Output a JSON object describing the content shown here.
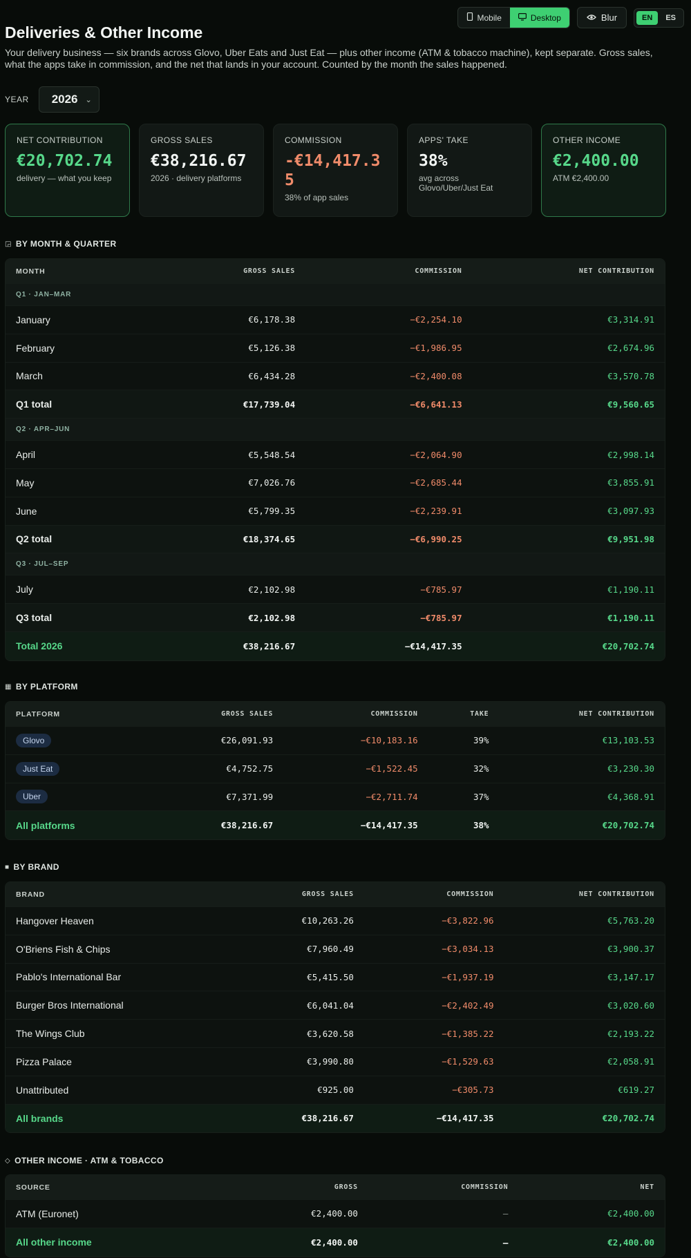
{
  "topbar": {
    "mobile_label": "Mobile",
    "desktop_label": "Desktop",
    "blur_label": "Blur",
    "lang_en": "EN",
    "lang_es": "ES"
  },
  "page": {
    "title": "Deliveries & Other Income",
    "subtitle": "Your delivery business — six brands across Glovo, Uber Eats and Just Eat — plus other income (ATM & tobacco machine), kept separate. Gross sales, what the apps take in commission, and the net that lands in your account. Counted by the month the sales happened."
  },
  "year": {
    "label": "YEAR",
    "value": "2026"
  },
  "cards": [
    {
      "label": "NET CONTRIBUTION",
      "value": "€20,702.74",
      "sub": "delivery — what you keep"
    },
    {
      "label": "GROSS SALES",
      "value": "€38,216.67",
      "sub": "2026 · delivery platforms"
    },
    {
      "label": "COMMISSION",
      "value": "-€14,417.35",
      "sub": "38% of app sales"
    },
    {
      "label": "APPS' TAKE",
      "value": "38%",
      "sub": "avg across Glovo/Uber/Just Eat"
    },
    {
      "label": "OTHER INCOME",
      "value": "€2,400.00",
      "sub": "ATM €2,400.00"
    }
  ],
  "month_section": {
    "title": "BY MONTH & QUARTER",
    "headers": [
      "MONTH",
      "GROSS SALES",
      "COMMISSION",
      "NET CONTRIBUTION"
    ],
    "q1": "Q1 · JAN–MAR",
    "q2": "Q2 · APR–JUN",
    "q3": "Q3 · JUL–SEP",
    "rows": {
      "jan": [
        "January",
        "€6,178.38",
        "−€2,254.10",
        "€3,314.91"
      ],
      "feb": [
        "February",
        "€5,126.38",
        "−€1,986.95",
        "€2,674.96"
      ],
      "mar": [
        "March",
        "€6,434.28",
        "−€2,400.08",
        "€3,570.78"
      ],
      "q1t": [
        "Q1 total",
        "€17,739.04",
        "−€6,641.13",
        "€9,560.65"
      ],
      "apr": [
        "April",
        "€5,548.54",
        "−€2,064.90",
        "€2,998.14"
      ],
      "may": [
        "May",
        "€7,026.76",
        "−€2,685.44",
        "€3,855.91"
      ],
      "jun": [
        "June",
        "€5,799.35",
        "−€2,239.91",
        "€3,097.93"
      ],
      "q2t": [
        "Q2 total",
        "€18,374.65",
        "−€6,990.25",
        "€9,951.98"
      ],
      "jul": [
        "July",
        "€2,102.98",
        "−€785.97",
        "€1,190.11"
      ],
      "q3t": [
        "Q3 total",
        "€2,102.98",
        "−€785.97",
        "€1,190.11"
      ],
      "year": [
        "Total 2026",
        "€38,216.67",
        "−€14,417.35",
        "€20,702.74"
      ]
    }
  },
  "platform_section": {
    "title": "BY PLATFORM",
    "headers": [
      "PLATFORM",
      "GROSS SALES",
      "COMMISSION",
      "TAKE",
      "NET CONTRIBUTION"
    ],
    "rows": [
      [
        "Glovo",
        "€26,091.93",
        "−€10,183.16",
        "39%",
        "€13,103.53"
      ],
      [
        "Just Eat",
        "€4,752.75",
        "−€1,522.45",
        "32%",
        "€3,230.30"
      ],
      [
        "Uber",
        "€7,371.99",
        "−€2,711.74",
        "37%",
        "€4,368.91"
      ]
    ],
    "total": [
      "All platforms",
      "€38,216.67",
      "−€14,417.35",
      "38%",
      "€20,702.74"
    ]
  },
  "brand_section": {
    "title": "BY BRAND",
    "headers": [
      "BRAND",
      "GROSS SALES",
      "COMMISSION",
      "NET CONTRIBUTION"
    ],
    "rows": [
      [
        "Hangover Heaven",
        "€10,263.26",
        "−€3,822.96",
        "€5,763.20"
      ],
      [
        "O'Briens Fish & Chips",
        "€7,960.49",
        "−€3,034.13",
        "€3,900.37"
      ],
      [
        "Pablo's International Bar",
        "€5,415.50",
        "−€1,937.19",
        "€3,147.17"
      ],
      [
        "Burger Bros International",
        "€6,041.04",
        "−€2,402.49",
        "€3,020.60"
      ],
      [
        "The Wings Club",
        "€3,620.58",
        "−€1,385.22",
        "€2,193.22"
      ],
      [
        "Pizza Palace",
        "€3,990.80",
        "−€1,529.63",
        "€2,058.91"
      ],
      [
        "Unattributed",
        "€925.00",
        "−€305.73",
        "€619.27"
      ]
    ],
    "total": [
      "All brands",
      "€38,216.67",
      "−€14,417.35",
      "€20,702.74"
    ]
  },
  "other_section": {
    "title": "OTHER INCOME · ATM & TOBACCO",
    "headers": [
      "SOURCE",
      "GROSS",
      "COMMISSION",
      "NET"
    ],
    "rows": [
      [
        "ATM (Euronet)",
        "€2,400.00",
        "–",
        "€2,400.00"
      ]
    ],
    "total": [
      "All other income",
      "€2,400.00",
      "–",
      "€2,400.00"
    ]
  },
  "colors": {
    "accent": "#3ecf72",
    "positive": "#57d88a",
    "negative": "#f08b6a",
    "background": "#080c09"
  }
}
